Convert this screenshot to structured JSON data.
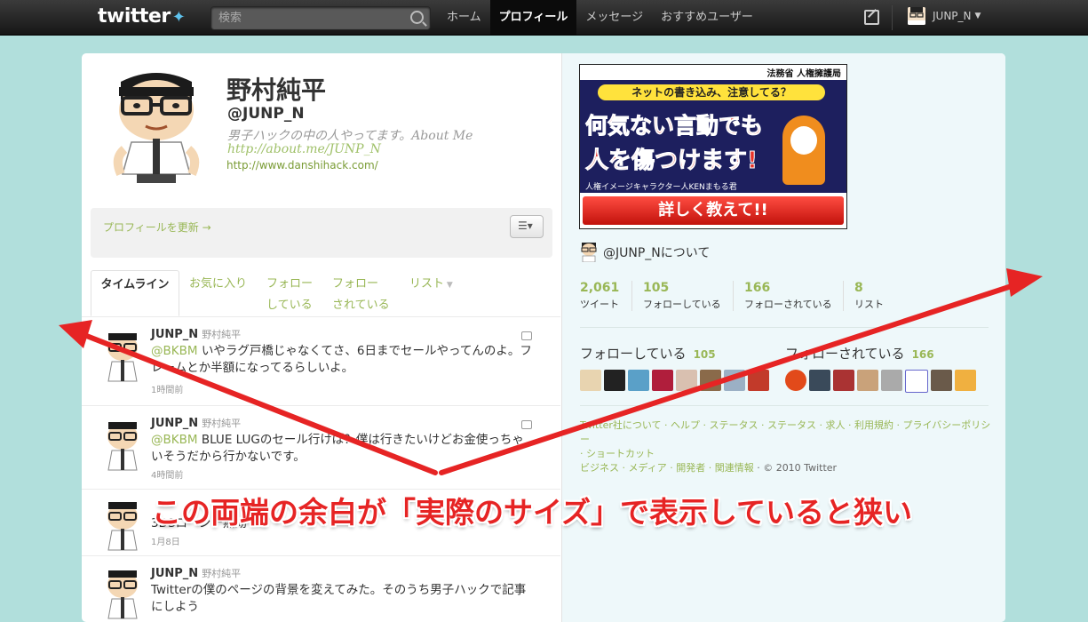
{
  "topbar": {
    "logo": "twitter",
    "search_placeholder": "検索",
    "nav": [
      "ホーム",
      "プロフィール",
      "メッセージ",
      "おすすめユーザー"
    ],
    "active_nav": "プロフィール",
    "username": "JUNP_N"
  },
  "profile": {
    "name": "野村純平",
    "handle": "@JUNP_N",
    "bio": "男子ハックの中の人やってます。About Me",
    "bio_link": "http://about.me/JUNP_N",
    "url": "http://www.danshihack.com/",
    "update_link": "プロフィールを更新 →"
  },
  "tabs": [
    {
      "label": "タイムライン",
      "active": true
    },
    {
      "label": "お気に入り"
    },
    {
      "line1": "フォロー",
      "line2": "している"
    },
    {
      "line1": "フォロー",
      "line2": "されている"
    },
    {
      "label": "リスト"
    }
  ],
  "tweets": [
    {
      "name": "JUNP_N",
      "realname": "野村純平",
      "mention": "@BKBM",
      "text": " いやラグ戸橋じゃなくてさ、6日までセールやってんのよ。フレームとか半額になってるらしいよ。",
      "time": "1時間前"
    },
    {
      "name": "JUNP_N",
      "realname": "野村純平",
      "mention": "@BKBM",
      "text": " BLUE LUGのセール行けば？僕は行きたいけどお金使っちゃいそうだから行かないです。",
      "time": "4時間前"
    },
    {
      "name": "",
      "realname": "",
      "mention": "",
      "text": "3DSローンチ無効",
      "time": "1月8日"
    },
    {
      "name": "JUNP_N",
      "realname": "野村純平",
      "mention": "",
      "text": "Twitterの僕のページの背景を変えてみた。そのうち男子ハックで記事にしよう",
      "time": ""
    }
  ],
  "ad": {
    "header": "法務省 人権擁護局",
    "bubble": "ネットの書き込み、注意してる？",
    "line1": "何気ない言動でも",
    "line2": "人を傷つけます!",
    "caption": "人権イメージキャラクター人KENまもる君",
    "button": "詳しく教えて!!",
    "colors": {
      "navy": "#1d1f5e",
      "red": "#e83229",
      "yellow": "#ffe23c"
    }
  },
  "about": {
    "label": "@JUNP_Nについて"
  },
  "stats": [
    {
      "n": "2,061",
      "l": "ツイート"
    },
    {
      "n": "105",
      "l": "フォローしている"
    },
    {
      "n": "166",
      "l": "フォローされている"
    },
    {
      "n": "8",
      "l": "リスト"
    }
  ],
  "following": {
    "label": "フォローしている",
    "count": "105"
  },
  "followers": {
    "label": "フォローされている",
    "count": "166"
  },
  "footer": {
    "line1": "Twitter社について · ヘルプ · ステータス · ステータス · 求人 · 利用規約 · プライバシーポリシー",
    "line2": "· ショートカット",
    "line3": "ビジネス · メディア · 開発者 · 関連情報",
    "copyright": " · © 2010 Twitter"
  },
  "annotation": {
    "caption": "この両端の余白が「実際のサイズ」で表示していると狭い",
    "arrow_color": "#e62424"
  },
  "accent_color": "#99b756"
}
